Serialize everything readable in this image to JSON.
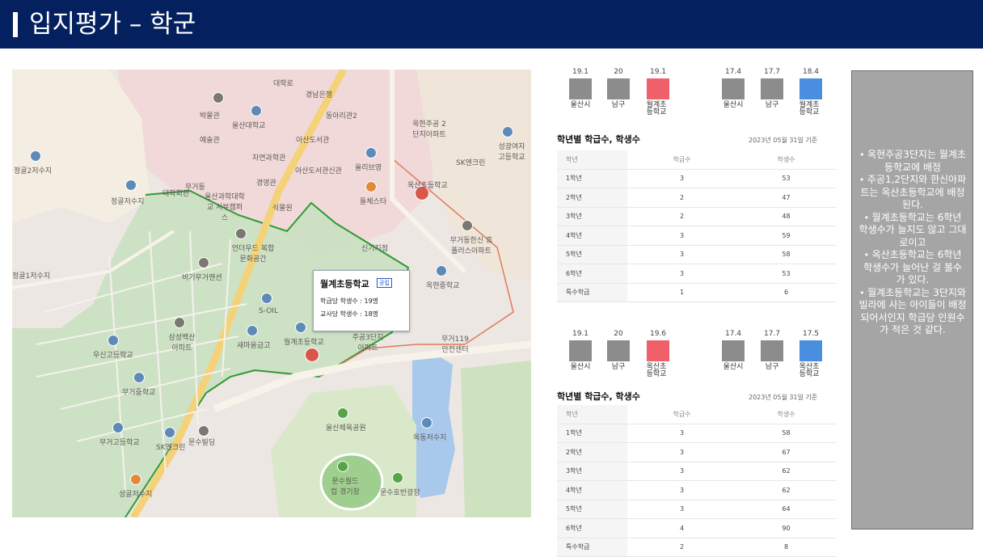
{
  "header": {
    "title": "입지평가 – 학군"
  },
  "map": {
    "labels": {
      "daehakro": "대학로",
      "gyeongnam_bank": "경남은행",
      "bakmulgwan": "박물관",
      "ulsan_univ": "울산대학교",
      "dongari": "동아리관2",
      "yesulgwan": "예술관",
      "asan_lib": "아산도서관",
      "okhyeon_apt": "옥현주공 2단지아파트",
      "sk_clean": "SK엔크린",
      "seongkwang": "성광여자 고등학교",
      "jayeon": "자연과학관",
      "olive": "올리브영",
      "gyeongyeong": "경영관",
      "asan_lib_new": "아산도서관신관",
      "jeonggol2": "정골2저수지",
      "daehakhoegwan": "대학회관",
      "mugeodong": "무거동",
      "ulsan_college": "울산과학대학교 서부캠퍼스",
      "sikmulwon": "식물원",
      "dolce": "돌체스타",
      "okhyeon_school_label": "옥산초등학교",
      "jeonggol_reservoir": "정골저수지",
      "sinjin": "신기지점",
      "mugeo_hanshin": "무거동한신 휴플러스아파트",
      "eondeo": "언더우드 복합문화공간",
      "bigi": "비기무거맨션",
      "okhyeon_middle": "옥현중학교",
      "jeonggol1": "정골1저수지",
      "soil": "S-OIL",
      "samsung_apt": "삼성백산 아파트",
      "saemaeul": "새마을금고",
      "wolgye_school_label": "월계초등학교",
      "jugong3": "주공3단지 아파트",
      "mugeo119": "무거119 안전센터",
      "usin_high": "우신고등학교",
      "mugeo_middle": "무거중학교",
      "sports_park": "울산체육공원",
      "okdong_reservoir": "옥동저수지",
      "mugeo_high": "무거고등학교",
      "sk_clean2": "SK엔크린",
      "villa": "문수빌딩",
      "world_cup": "문수월드컵 경기장",
      "munsu_plaza": "문수호반광장",
      "seonggol": "성골저수지"
    },
    "popup": {
      "name": "월계초등학교",
      "tag": "공립",
      "line1": "학급당 학생수 : 19명",
      "line2": "교사당 학생수 : 18명"
    }
  },
  "comparisons": [
    {
      "groups": [
        {
          "items": [
            {
              "value": "19.1",
              "label": "울산시",
              "color": "#8c8c8c"
            },
            {
              "value": "20",
              "label": "남구",
              "color": "#8c8c8c"
            },
            {
              "value": "19.1",
              "label": "월계초 등학교",
              "color": "#f0606a"
            }
          ]
        },
        {
          "items": [
            {
              "value": "17.4",
              "label": "울산시",
              "color": "#8c8c8c"
            },
            {
              "value": "17.7",
              "label": "남구",
              "color": "#8c8c8c"
            },
            {
              "value": "18.4",
              "label": "월계초 등학교",
              "color": "#4a8ee0"
            }
          ]
        }
      ]
    },
    {
      "groups": [
        {
          "items": [
            {
              "value": "19.1",
              "label": "울산시",
              "color": "#8c8c8c"
            },
            {
              "value": "20",
              "label": "남구",
              "color": "#8c8c8c"
            },
            {
              "value": "19.6",
              "label": "옥산초 등학교",
              "color": "#f0606a"
            }
          ]
        },
        {
          "items": [
            {
              "value": "17.4",
              "label": "울산시",
              "color": "#8c8c8c"
            },
            {
              "value": "17.7",
              "label": "남구",
              "color": "#8c8c8c"
            },
            {
              "value": "17.5",
              "label": "옥산초 등학교",
              "color": "#4a8ee0"
            }
          ]
        }
      ]
    }
  ],
  "tables": [
    {
      "title": "학년별 학급수, 학생수",
      "date": "2023년 05월 31일 기준",
      "headers": [
        "학년",
        "학급수",
        "학생수"
      ],
      "rows": [
        [
          "1학년",
          "3",
          "53"
        ],
        [
          "2학년",
          "2",
          "47"
        ],
        [
          "3학년",
          "2",
          "48"
        ],
        [
          "4학년",
          "3",
          "59"
        ],
        [
          "5학년",
          "3",
          "58"
        ],
        [
          "6학년",
          "3",
          "53"
        ],
        [
          "특수학급",
          "1",
          "6"
        ]
      ]
    },
    {
      "title": "학년별 학급수, 학생수",
      "date": "2023년 05월 31일 기준",
      "headers": [
        "학년",
        "학급수",
        "학생수"
      ],
      "rows": [
        [
          "1학년",
          "3",
          "58"
        ],
        [
          "2학년",
          "3",
          "67"
        ],
        [
          "3학년",
          "3",
          "62"
        ],
        [
          "4학년",
          "3",
          "62"
        ],
        [
          "5학년",
          "3",
          "64"
        ],
        [
          "6학년",
          "4",
          "90"
        ],
        [
          "특수학급",
          "2",
          "8"
        ]
      ]
    }
  ],
  "notes": [
    "옥현주공3단지는 월계초등학교에 배정",
    "주공1,2단지와 한신아파트는 옥산초등학교에 배정된다.",
    "월계초등학교는 6학년 학생수가 늘지도 않고 그대로이고",
    "옥산초등학교는 6학년 학생수가 늘어난 걸 볼수 가 있다.",
    "월계초등학교는 3단지와 빌라에 사는 아이들이 배정되어서인지 학급당 인원수가 적은 것 같다."
  ]
}
